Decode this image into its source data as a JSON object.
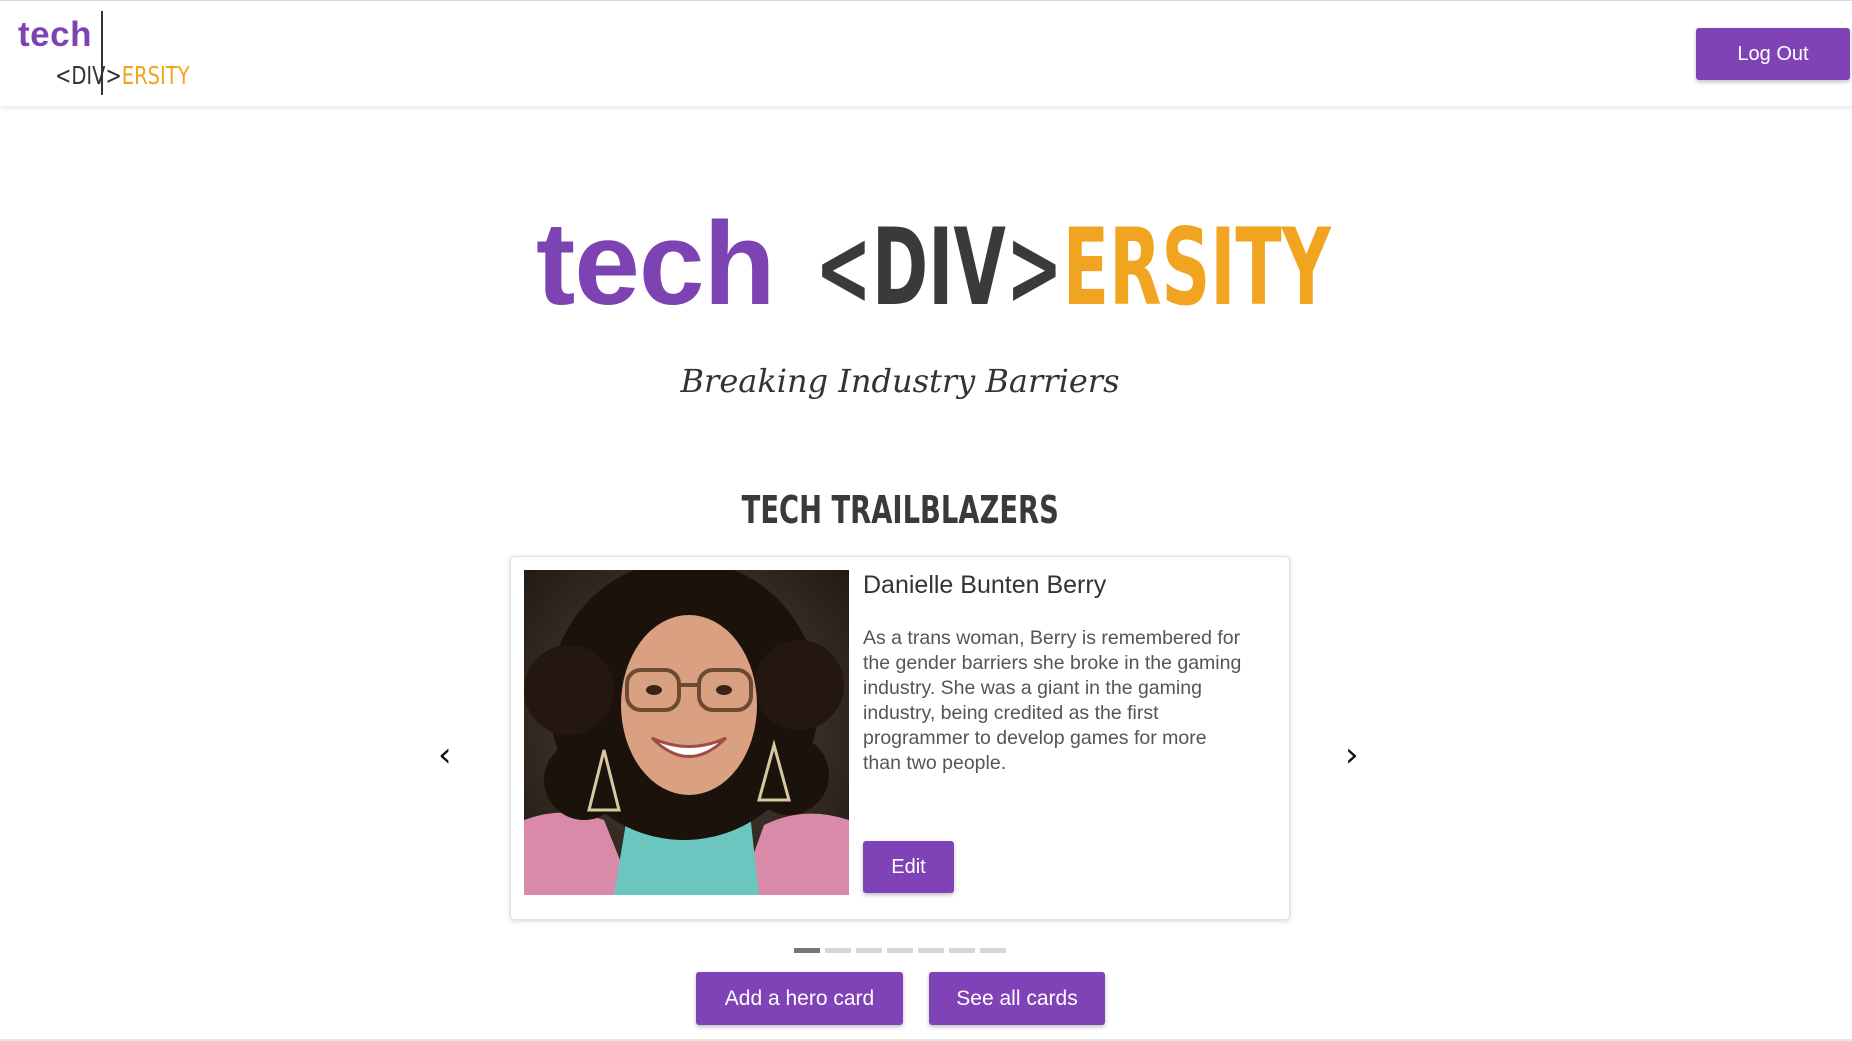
{
  "navbar": {
    "logo": {
      "tech": "tech",
      "div": "<DIV>",
      "ersity": "ERSITY"
    },
    "logout_label": "Log Out"
  },
  "hero": {
    "tech": "tech",
    "div": "<DIV>",
    "ersity": "ERSITY",
    "tagline": "Breaking Industry Barriers"
  },
  "section": {
    "heading": "TECH TRAILBLAZERS"
  },
  "carousel": {
    "prev_icon": "‹",
    "next_icon": "›",
    "slide_count": 7,
    "active_index": 0,
    "card": {
      "name": "Danielle Bunten Berry",
      "bio": "As a trans woman, Berry is remembered for the gender barriers she broke in the gaming industry. She was a giant in the gaming industry, being credited as the first programmer to develop games for more than two people.",
      "edit_label": "Edit"
    }
  },
  "actions": {
    "add_label": "Add a hero card",
    "see_label": "See all cards"
  },
  "colors": {
    "brand_purple": "#7e43b2",
    "button_purple": "#8042b7",
    "brand_orange": "#f0a420",
    "dark_text": "#333333"
  },
  "icons": {
    "prev": "chevron-left-icon",
    "next": "chevron-right-icon"
  }
}
